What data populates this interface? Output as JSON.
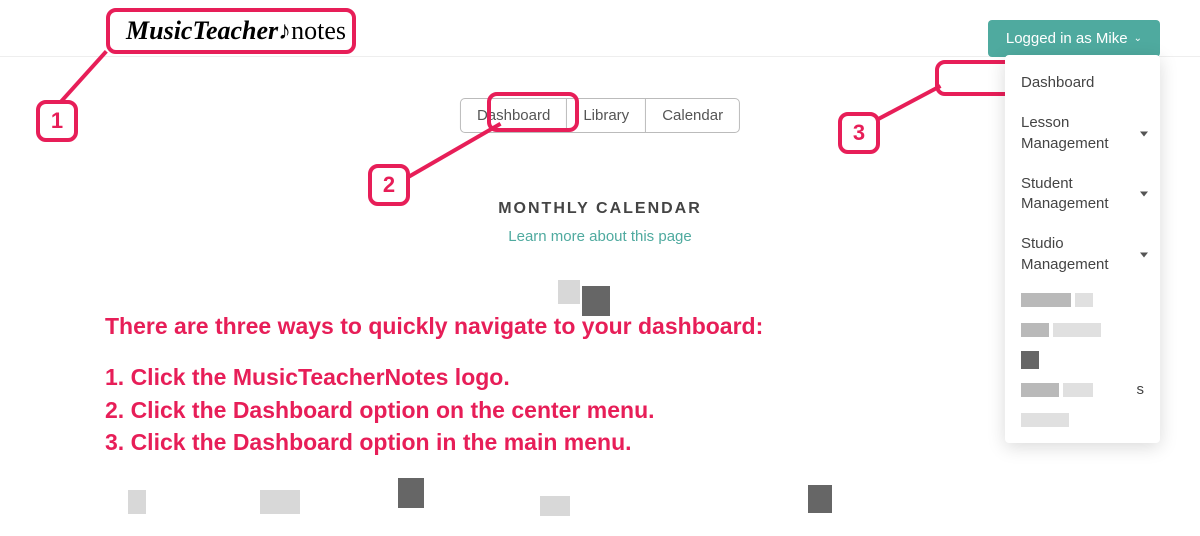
{
  "header": {
    "logo_main": "MusicTeacher",
    "logo_accent": "♪notes",
    "login_label": "Logged in as Mike"
  },
  "tabs": {
    "items": [
      "Dashboard",
      "Library",
      "Calendar"
    ]
  },
  "page": {
    "title": "MONTHLY CALENDAR",
    "learn_more": "Learn more about this page"
  },
  "dropdown": {
    "items": [
      {
        "label": "Dashboard",
        "has_caret": false
      },
      {
        "label": "Lesson Management",
        "has_caret": true
      },
      {
        "label": "Student Management",
        "has_caret": true
      },
      {
        "label": "Studio Management",
        "has_caret": true
      }
    ],
    "trailing_text": "s"
  },
  "annotation": {
    "intro": "There are three ways to quickly navigate to your dashboard:",
    "steps": [
      "1. Click the MusicTeacherNotes logo.",
      "2. Click the Dashboard option on the center menu.",
      "3. Click the Dashboard option in the main menu."
    ],
    "numbers": [
      "1",
      "2",
      "3"
    ]
  }
}
